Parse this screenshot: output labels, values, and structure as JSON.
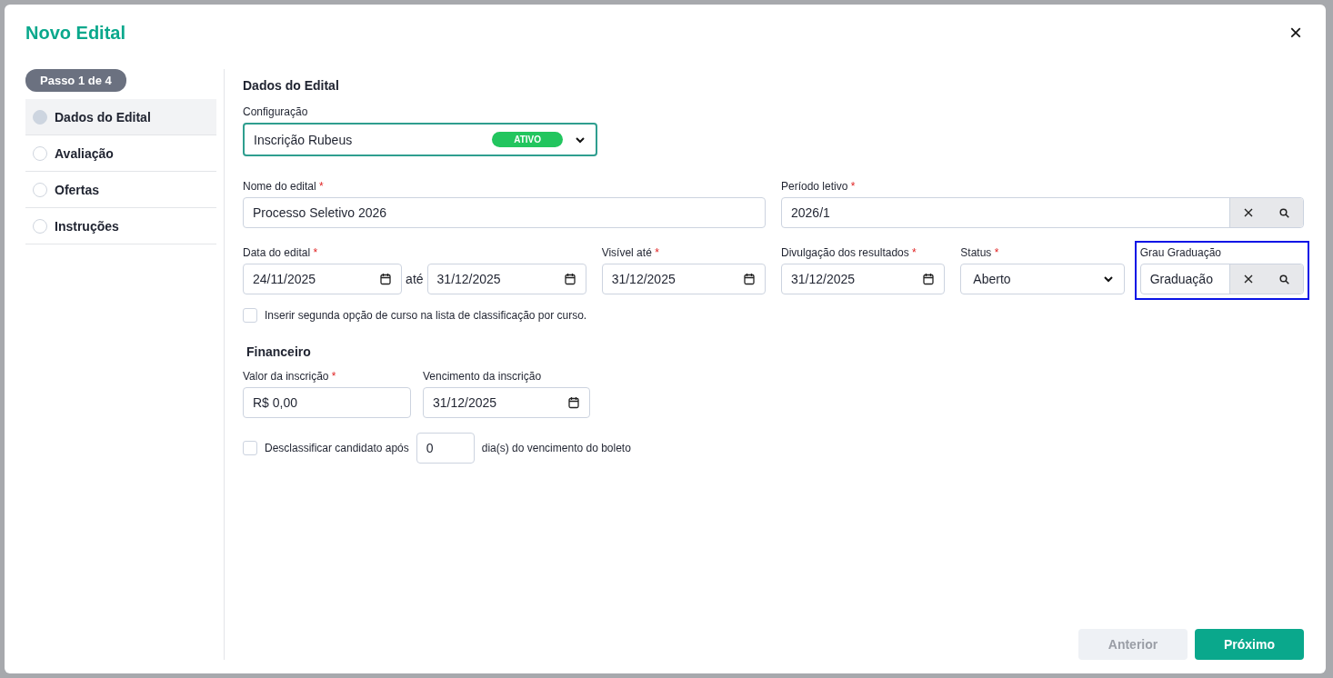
{
  "dialog": {
    "title": "Novo Edital",
    "close_label": "×"
  },
  "stepper": {
    "badge": "Passo 1 de 4",
    "steps": [
      {
        "label": "Dados do Edital",
        "selected": true
      },
      {
        "label": "Avaliação",
        "selected": false
      },
      {
        "label": "Ofertas",
        "selected": false
      },
      {
        "label": "Instruções",
        "selected": false
      }
    ]
  },
  "section_title": "Dados do Edital",
  "configuration": {
    "label": "Configuração",
    "value": "Inscrição Rubeus",
    "badge": "ATIVO"
  },
  "fields": [
    {
      "kind": "text",
      "label": "Nome do edital",
      "required_mark": "*",
      "value": "Processo Seletivo 2026"
    },
    {
      "kind": "lookup",
      "label": "Período letivo",
      "required_mark": "*",
      "value": "2026/1"
    },
    {
      "kind": "date_range",
      "label": "Data do edital",
      "required_mark": "*",
      "value": "24/11/2025",
      "separator": "até",
      "value_end": "31/12/2025"
    },
    {
      "kind": "date",
      "label": "Visível até",
      "required_mark": "*",
      "value": "31/12/2025"
    },
    {
      "kind": "date",
      "label": "Divulgação dos resultados",
      "required_mark": "*",
      "value": "31/12/2025"
    },
    {
      "kind": "select",
      "label": "Status",
      "required_mark": "*",
      "value": "Aberto"
    },
    {
      "kind": "lookup",
      "label": "Grau Graduação",
      "value": "Graduação",
      "highlighted": true
    }
  ],
  "second_option": {
    "label": "Inserir segunda opção de curso na lista de classificação por curso.",
    "checked": false
  },
  "financial": {
    "title": "Financeiro",
    "fields": [
      {
        "kind": "text",
        "label": "Valor da inscrição",
        "required_mark": "*",
        "value": "R$ 0,00"
      },
      {
        "kind": "date",
        "label": "Vencimento da inscrição",
        "value": "31/12/2025"
      }
    ],
    "disqualify": {
      "label_before": "Desclassificar candidato após",
      "value": "0",
      "label_after": "dia(s) do vencimento do boleto",
      "checked": false
    }
  },
  "footer": {
    "buttons": [
      {
        "label": "Anterior",
        "disabled": true
      },
      {
        "label": "Próximo",
        "disabled": false
      }
    ]
  }
}
